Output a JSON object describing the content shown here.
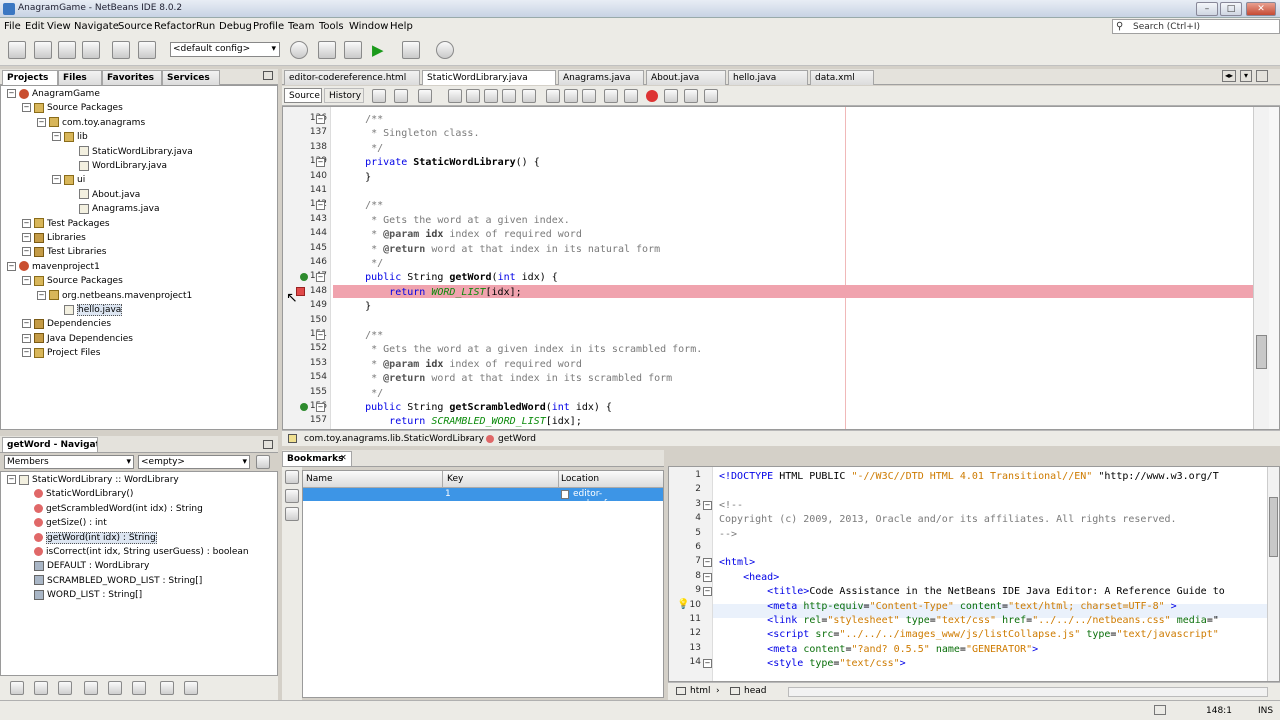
{
  "window": {
    "title": "AnagramGame - NetBeans IDE 8.0.2"
  },
  "menu": [
    "File",
    "Edit",
    "View",
    "Navigate",
    "Source",
    "Refactor",
    "Run",
    "Debug",
    "Profile",
    "Team",
    "Tools",
    "Window",
    "Help"
  ],
  "search_placeholder": "Search (Ctrl+I)",
  "toolbar": {
    "config": "<default config>"
  },
  "left_tabs": [
    "Projects",
    "Files",
    "Favorites",
    "Services"
  ],
  "projects_tree": [
    {
      "label": "AnagramGame",
      "level": 0,
      "icon": "project-icon"
    },
    {
      "label": "Source Packages",
      "level": 1,
      "icon": "package-folder-icon"
    },
    {
      "label": "com.toy.anagrams",
      "level": 2,
      "icon": "package-icon"
    },
    {
      "label": "lib",
      "level": 3,
      "icon": "package-icon"
    },
    {
      "label": "StaticWordLibrary.java",
      "level": 4,
      "icon": "java-file-icon"
    },
    {
      "label": "WordLibrary.java",
      "level": 4,
      "icon": "java-file-icon"
    },
    {
      "label": "ui",
      "level": 3,
      "icon": "package-icon"
    },
    {
      "label": "About.java",
      "level": 4,
      "icon": "java-file-icon"
    },
    {
      "label": "Anagrams.java",
      "level": 4,
      "icon": "java-file-icon"
    },
    {
      "label": "Test Packages",
      "level": 1,
      "icon": "package-folder-icon"
    },
    {
      "label": "Libraries",
      "level": 1,
      "icon": "library-icon"
    },
    {
      "label": "Test Libraries",
      "level": 1,
      "icon": "library-icon"
    },
    {
      "label": "mavenproject1",
      "level": 0,
      "icon": "project-icon"
    },
    {
      "label": "Source Packages",
      "level": 1,
      "icon": "package-folder-icon"
    },
    {
      "label": "org.netbeans.mavenproject1",
      "level": 2,
      "icon": "package-icon"
    },
    {
      "label": "hello.java",
      "level": 3,
      "icon": "java-file-icon"
    },
    {
      "label": "Dependencies",
      "level": 1,
      "icon": "library-icon"
    },
    {
      "label": "Java Dependencies",
      "level": 1,
      "icon": "library-icon"
    },
    {
      "label": "Project Files",
      "level": 1,
      "icon": "package-folder-icon"
    }
  ],
  "navigator": {
    "title": "getWord - Navigator",
    "filter": "Members",
    "scope": "<empty>",
    "items": [
      {
        "label": "StaticWordLibrary :: WordLibrary",
        "level": 0,
        "icon": "class-icon"
      },
      {
        "label": "StaticWordLibrary()",
        "level": 1,
        "icon": "constructor-icon"
      },
      {
        "label": "getScrambledWord(int idx) : String",
        "level": 1,
        "icon": "method-icon"
      },
      {
        "label": "getSize() : int",
        "level": 1,
        "icon": "method-icon"
      },
      {
        "label": "getWord(int idx) : String",
        "level": 1,
        "icon": "method-icon"
      },
      {
        "label": "isCorrect(int idx, String userGuess) : boolean",
        "level": 1,
        "icon": "method-icon"
      },
      {
        "label": "DEFAULT : WordLibrary",
        "level": 1,
        "icon": "field-icon"
      },
      {
        "label": "SCRAMBLED_WORD_LIST : String[]",
        "level": 1,
        "icon": "field-icon"
      },
      {
        "label": "WORD_LIST : String[]",
        "level": 1,
        "icon": "field-icon"
      }
    ]
  },
  "editor_tabs": [
    "editor-codereference.html",
    "StaticWordLibrary.java",
    "Anagrams.java",
    "About.java",
    "hello.java",
    "data.xml"
  ],
  "editor_subtabs": [
    "Source",
    "History"
  ],
  "code_lines": [
    {
      "n": "136",
      "html": "    /**"
    },
    {
      "n": "137",
      "html": "     * Singleton class."
    },
    {
      "n": "138",
      "html": "     */"
    },
    {
      "n": "139",
      "html": "    private StaticWordLibrary() {"
    },
    {
      "n": "140",
      "html": "    }"
    },
    {
      "n": "141",
      "html": ""
    },
    {
      "n": "142",
      "html": "    /**"
    },
    {
      "n": "143",
      "html": "     * Gets the word at a given index."
    },
    {
      "n": "144",
      "html": "     * @param idx index of required word"
    },
    {
      "n": "145",
      "html": "     * @return word at that index in its natural form"
    },
    {
      "n": "146",
      "html": "     */"
    },
    {
      "n": "147",
      "html": "    public String getWord(int idx) {"
    },
    {
      "n": "148",
      "html": "        return WORD_LIST[idx];"
    },
    {
      "n": "149",
      "html": "    }"
    },
    {
      "n": "150",
      "html": ""
    },
    {
      "n": "151",
      "html": "    /**"
    },
    {
      "n": "152",
      "html": "     * Gets the word at a given index in its scrambled form."
    },
    {
      "n": "153",
      "html": "     * @param idx index of required word"
    },
    {
      "n": "154",
      "html": "     * @return word at that index in its scrambled form"
    },
    {
      "n": "155",
      "html": "     */"
    },
    {
      "n": "156",
      "html": "    public String getScrambledWord(int idx) {"
    },
    {
      "n": "157",
      "html": "        return SCRAMBLED_WORD_LIST[idx];"
    }
  ],
  "breadcrumbs": [
    "com.toy.anagrams.lib.StaticWordLibrary",
    "getWord"
  ],
  "bookmarks": {
    "title": "Bookmarks",
    "columns": [
      "Name",
      "Key",
      "Location"
    ],
    "row": {
      "name": "",
      "key": "1",
      "location": "editor-codereferenc..."
    }
  },
  "html_lines": [
    {
      "n": "1",
      "html": "<!DOCTYPE HTML PUBLIC \"-//W3C//DTD HTML 4.01 Transitional//EN\" \"http://www.w3.org/T"
    },
    {
      "n": "2",
      "html": ""
    },
    {
      "n": "3",
      "html": "<!--"
    },
    {
      "n": "4",
      "html": "Copyright (c) 2009, 2013, Oracle and/or its affiliates. All rights reserved."
    },
    {
      "n": "5",
      "html": "-->"
    },
    {
      "n": "6",
      "html": ""
    },
    {
      "n": "7",
      "html": "<html>"
    },
    {
      "n": "8",
      "html": "    <head>"
    },
    {
      "n": "9",
      "html": "        <title>Code Assistance in the NetBeans IDE Java Editor: A Reference Guide to"
    },
    {
      "n": "10",
      "html": "        <meta http-equiv=\"Content-Type\" content=\"text/html; charset=UTF-8\" >"
    },
    {
      "n": "11",
      "html": "        <link rel=\"stylesheet\" type=\"text/css\" href=\"../../../netbeans.css\" media=\""
    },
    {
      "n": "12",
      "html": "        <script src=\"../../../images_www/js/listCollapse.js\" type=\"text/javascript\""
    },
    {
      "n": "13",
      "html": "        <meta content=\"?and? 0.5.5\" name=\"GENERATOR\">"
    },
    {
      "n": "14",
      "html": "        <style type=\"text/css\">"
    }
  ],
  "html_breadcrumbs": [
    "html",
    "head"
  ],
  "status": {
    "position": "148:1",
    "mode": "INS"
  }
}
